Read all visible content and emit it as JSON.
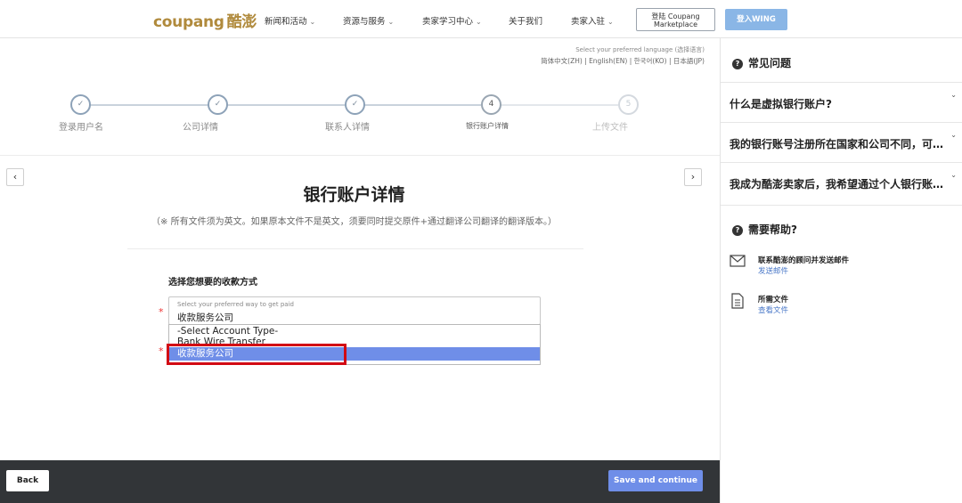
{
  "header": {
    "logo_brand": "coupang",
    "logo_cn": "酷澎",
    "nav": [
      {
        "label": "新闻和活动",
        "has_dropdown": true
      },
      {
        "label": "资源与服务",
        "has_dropdown": true
      },
      {
        "label": "卖家学习中心",
        "has_dropdown": true
      },
      {
        "label": "关于我们",
        "has_dropdown": false
      },
      {
        "label": "卖家入驻",
        "has_dropdown": true
      }
    ],
    "login_line1": "登陆 Coupang",
    "login_line2": "Marketplace",
    "wing_label": "登入WING"
  },
  "language": {
    "hint": "Select your preferred language (选择语言)",
    "options": "简体中文(ZH) | English(EN) | 한국어(KO) | 日本語(JP)"
  },
  "steps": [
    {
      "index": "1",
      "label": "登录用户名",
      "state": "done"
    },
    {
      "index": "2",
      "label": "公司详情",
      "state": "done"
    },
    {
      "index": "3",
      "label": "联系人详情",
      "state": "done"
    },
    {
      "index": "4",
      "label": "银行账户详情",
      "state": "current"
    },
    {
      "index": "5",
      "label": "上传文件",
      "state": "pending"
    }
  ],
  "nav_arrows": {
    "prev": "‹",
    "next": "›"
  },
  "form": {
    "title": "银行账户详情",
    "note": "（※ 所有文件须为英文。如果原本文件不是英文，须要同时提交原件+通过翻译公司翻译的翻译版本。）",
    "field_title": "选择您想要的收款方式",
    "required_mark": "*",
    "select_hint": "Select your preferred way to get paid",
    "select_value": "收款服务公司",
    "options": [
      "-Select Account Type-",
      "Bank Wire Transfer",
      "收款服务公司"
    ],
    "selected_option": "收款服务公司"
  },
  "footer": {
    "back_label": "Back",
    "save_label": "Save and continue"
  },
  "sidebar": {
    "faq_heading": "常见问题",
    "faq": [
      "什么是虚拟银行账户?",
      "我的银行账号注册所在国家和公司不同，可以吗？",
      "我成为酷澎卖家后，我希望通过个人银行账户收款，可以吗？"
    ],
    "help_heading": "需要帮助?",
    "help_items": [
      {
        "title": "联系酷澎的顾问并发送邮件",
        "link": "发送邮件"
      },
      {
        "title": "所需文件",
        "link": "查看文件"
      }
    ]
  },
  "colors": {
    "brand": "#b08a3c",
    "primary": "#6f8ee8",
    "wing": "#8ab6e6",
    "footer_bg": "#323538",
    "highlight": "#d20a14"
  }
}
